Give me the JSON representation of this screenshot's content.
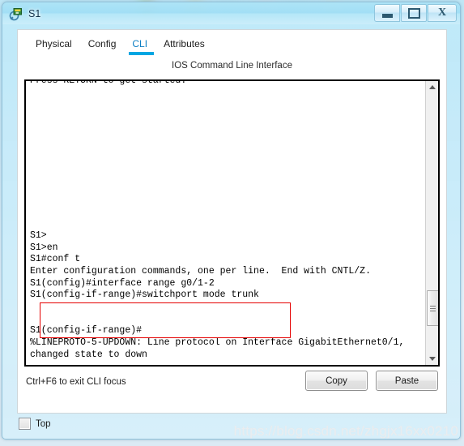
{
  "window": {
    "title": "S1",
    "icon": "switch-icon",
    "buttons": {
      "minimize": "minimize-icon",
      "maximize": "restore-icon",
      "close": "close-icon",
      "minimize_label": "",
      "maximize_label": "",
      "close_label": "X"
    }
  },
  "tabs": [
    {
      "label": "Physical",
      "active": false
    },
    {
      "label": "Config",
      "active": false
    },
    {
      "label": "CLI",
      "active": true
    },
    {
      "label": "Attributes",
      "active": false
    }
  ],
  "panel": {
    "title": "IOS Command Line Interface"
  },
  "terminal": {
    "lines": [
      "Press RETURN to get started.",
      "",
      "",
      "",
      "",
      "",
      "",
      "",
      "",
      "",
      "",
      "",
      "",
      "S1>",
      "S1>en",
      "S1#conf t",
      "Enter configuration commands, one per line.  End with CNTL/Z.",
      "S1(config)#interface range g0/1-2",
      "S1(config-if-range)#switchport mode trunk",
      "",
      "",
      "S1(config-if-range)#",
      "%LINEPROTO-5-UPDOWN: Line protocol on Interface GigabitEthernet0/1,",
      "changed state to down"
    ],
    "highlight_color": "#e50000",
    "scroll_up_icon": "triangle-up-icon",
    "scroll_down_icon": "triangle-down-icon"
  },
  "footer": {
    "hint": "Ctrl+F6 to exit CLI focus",
    "copy_label": "Copy",
    "paste_label": "Paste"
  },
  "bottom": {
    "top_checkbox_label": "Top",
    "top_checked": false
  },
  "watermark": "https://blog.csdn.net/zhgjx16xx0210",
  "colors": {
    "accent": "#00a6e2",
    "active_tab_text": "#0d7fc4",
    "highlight": "#e50000",
    "titlebar": "#a8e2f6"
  }
}
